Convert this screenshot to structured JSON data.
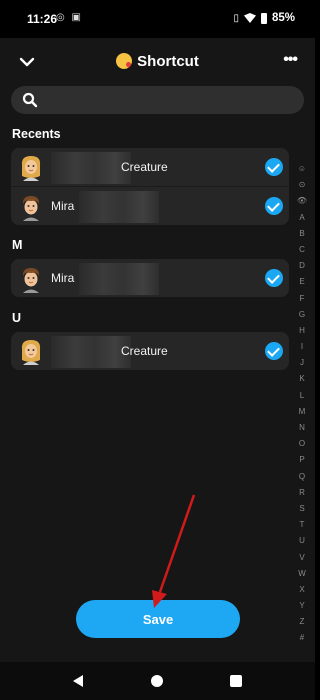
{
  "status_bar": {
    "time": "11:26",
    "battery": "85%"
  },
  "header": {
    "title": "Shortcut",
    "more_glyph": "•••"
  },
  "search": {
    "placeholder": "",
    "value": ""
  },
  "sections": [
    {
      "label": "Recents"
    },
    {
      "label": "M"
    },
    {
      "label": "U"
    }
  ],
  "rows": {
    "recents_1": {
      "name": "Creature",
      "checked": true
    },
    "recents_2": {
      "name": "Mira",
      "checked": true
    },
    "m_1": {
      "name": "Mira",
      "checked": true
    },
    "u_1": {
      "name": "Creature",
      "checked": true
    }
  },
  "index_letters": [
    "☺",
    "⊙",
    "👁",
    "A",
    "B",
    "C",
    "D",
    "E",
    "F",
    "G",
    "H",
    "I",
    "J",
    "K",
    "L",
    "M",
    "N",
    "O",
    "P",
    "Q",
    "R",
    "S",
    "T",
    "U",
    "V",
    "W",
    "X",
    "Y",
    "Z",
    "#"
  ],
  "save_label": "Save",
  "colors": {
    "accent": "#1ea8f4",
    "surface": "#161616",
    "card": "#262626",
    "annotation_arrow": "#d11b1b"
  }
}
